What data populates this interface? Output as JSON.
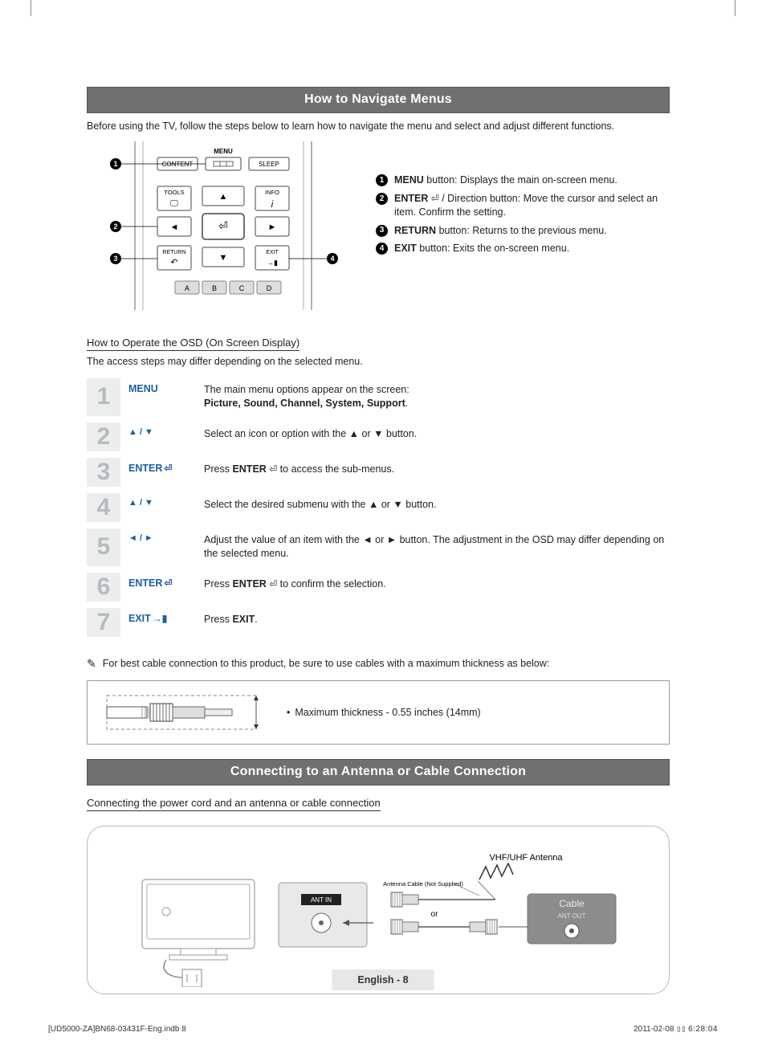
{
  "section1_title": "How to Navigate Menus",
  "intro_text": "Before using the TV, follow the steps below to learn how to navigate the menu and select and adjust different functions.",
  "remote": {
    "labels": {
      "content": "CONTENT",
      "menu": "MENU",
      "sleep": "SLEEP",
      "tools": "TOOLS",
      "info": "INFO",
      "return": "RETURN",
      "exit": "EXIT",
      "a": "A",
      "b": "B",
      "c": "C",
      "d": "D"
    }
  },
  "callouts": [
    {
      "n": "1",
      "bold": "MENU",
      "text": " button: Displays the main on-screen menu."
    },
    {
      "n": "2",
      "bold": "ENTER",
      "icon": "E",
      "text": " / Direction button: Move the cursor and select an item. Confirm the setting."
    },
    {
      "n": "3",
      "bold": "RETURN",
      "text": " button: Returns to the previous menu."
    },
    {
      "n": "4",
      "bold": "EXIT",
      "text": " button: Exits the on-screen menu."
    }
  ],
  "osd_heading": "How to Operate the OSD (On Screen Display)",
  "osd_sub": "The access steps may differ depending on the selected menu.",
  "steps": [
    {
      "n": "1",
      "key": "MENU",
      "desc_pre": "The main menu options appear on the screen:",
      "desc_bold": "Picture, Sound, Channel, System, Support",
      "desc_post": "."
    },
    {
      "n": "2",
      "key": "▲ / ▼",
      "desc": "Select an icon or option with the ▲ or ▼ button."
    },
    {
      "n": "3",
      "key": "ENTER",
      "key_icon": "E",
      "desc_pre": "Press ",
      "desc_bold": "ENTER",
      "desc_icon": "E",
      "desc_post": " to access the sub-menus."
    },
    {
      "n": "4",
      "key": "▲ / ▼",
      "desc": "Select the desired submenu with the ▲ or ▼ button."
    },
    {
      "n": "5",
      "key": "◄ / ►",
      "desc": "Adjust the value of an item with the ◄ or ► button. The adjustment in the OSD may differ depending on the selected menu."
    },
    {
      "n": "6",
      "key": "ENTER",
      "key_icon": "E",
      "desc_pre": "Press ",
      "desc_bold": "ENTER",
      "desc_icon": "E",
      "desc_post": " to confirm the selection."
    },
    {
      "n": "7",
      "key": "EXIT",
      "key_exit_icon": true,
      "desc_pre": "Press ",
      "desc_bold": "EXIT",
      "desc_post": "."
    }
  ],
  "cable_note": "For best cable connection to this product, be sure to use cables with a maximum thickness as below:",
  "cable_max": "Maximum thickness - 0.55 inches (14mm)",
  "section2_title": "Connecting to an Antenna or Cable Connection",
  "conn_heading": "Connecting the power cord and an antenna or cable connection",
  "ant_labels": {
    "vhf": "VHF/UHF Antenna",
    "not_supplied": "Antenna Cable (Not Supplied)",
    "ant_in": "ANT IN",
    "or": "or",
    "cable": "Cable",
    "ant_out": "ANT OUT"
  },
  "footer_lang": "English - 8",
  "footer_left": "[UD5000-ZA]BN68-03431F-Eng.indb   8",
  "footer_date": "2011-02-08   ",
  "footer_time": "6:28:04"
}
